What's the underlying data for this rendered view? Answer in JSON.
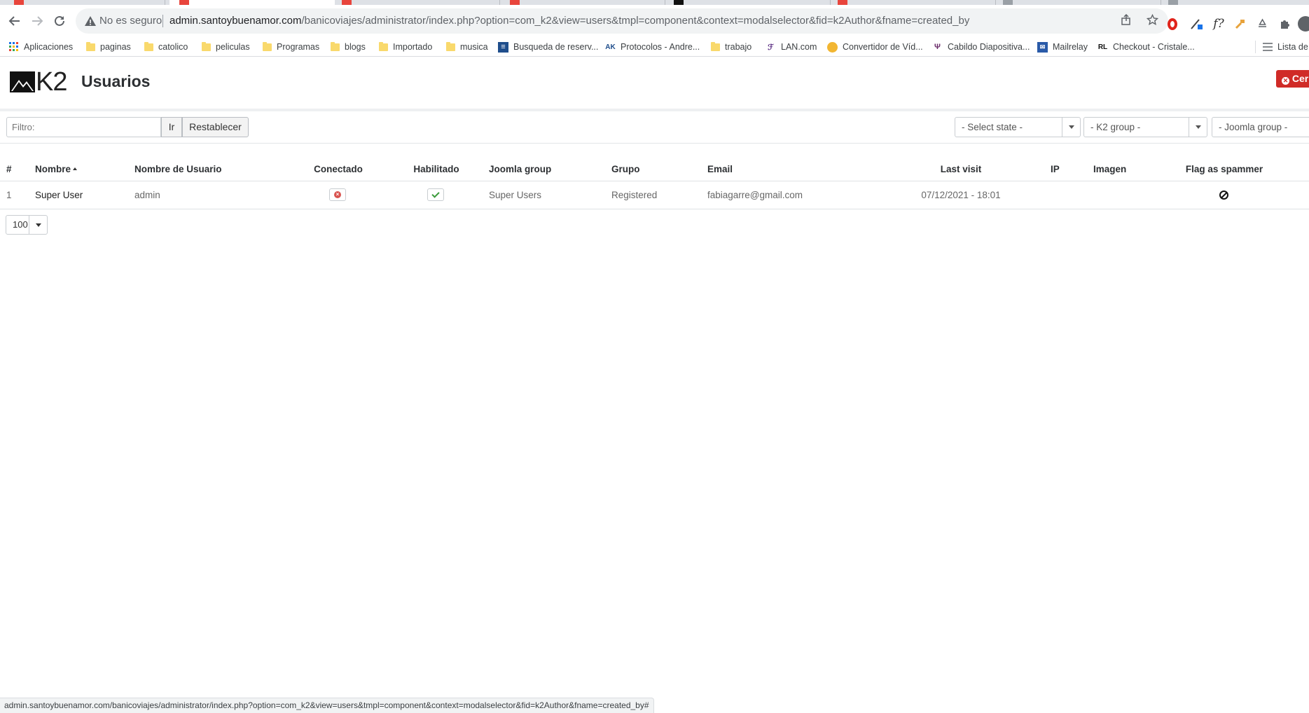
{
  "browser": {
    "security_text": "No es seguro",
    "url_host": "admin.santoybuenamor.com",
    "url_path": "/banicoviajes/administrator/index.php?option=com_k2&view=users&tmpl=component&context=modalselector&fid=k2Author&fname=created_by",
    "bookmarks": [
      {
        "label": "Aplicaciones",
        "icon": "apps-grid-icon"
      },
      {
        "label": "paginas",
        "icon": "folder-icon"
      },
      {
        "label": "catolico",
        "icon": "folder-icon"
      },
      {
        "label": "peliculas",
        "icon": "folder-icon"
      },
      {
        "label": "Programas",
        "icon": "folder-icon"
      },
      {
        "label": "blogs",
        "icon": "folder-icon"
      },
      {
        "label": "Importado",
        "icon": "folder-icon"
      },
      {
        "label": "musica",
        "icon": "folder-icon"
      },
      {
        "label": "Busqueda de reserv...",
        "icon": "site-icon"
      },
      {
        "label": "Protocolos - Andre...",
        "icon": "site-icon"
      },
      {
        "label": "trabajo",
        "icon": "folder-icon"
      },
      {
        "label": "LAN.com",
        "icon": "site-icon"
      },
      {
        "label": "Convertidor de Víd...",
        "icon": "site-icon"
      },
      {
        "label": "Cabildo Diapositiva...",
        "icon": "site-icon"
      },
      {
        "label": "Mailrelay",
        "icon": "site-icon"
      },
      {
        "label": "Checkout - Cristale...",
        "icon": "site-icon"
      }
    ],
    "reading_list": "Lista de",
    "ext_f_label": "f?",
    "rl_badge": "RL",
    "ak_badge": "AK"
  },
  "k2": {
    "logo_text": "K2",
    "title": "Usuarios",
    "close_label": "Cer",
    "filter_placeholder": "Filtro:",
    "go_label": "Ir",
    "reset_label": "Restablecer",
    "select_state": "- Select state -",
    "k2_group": "- K2 group -",
    "joomla_group": "- Joomla group -",
    "columns": {
      "num": "#",
      "name": "Nombre",
      "username": "Nombre de Usuario",
      "logged": "Conectado",
      "enabled": "Habilitado",
      "joomla_group": "Joomla group",
      "group": "Grupo",
      "email": "Email",
      "last_visit": "Last visit",
      "ip": "IP",
      "image": "Imagen",
      "spammer": "Flag as spammer"
    },
    "rows": [
      {
        "num": "1",
        "name": "Super User",
        "username": "admin",
        "logged_in": false,
        "enabled": true,
        "joomla_group": "Super Users",
        "group": "Registered",
        "email": "fabiagarre@gmail.com",
        "last_visit": "07/12/2021 - 18:01",
        "ip": "",
        "image": ""
      }
    ],
    "list_limit": "100"
  },
  "status_bar": "admin.santoybuenamor.com/banicoviajes/administrator/index.php?option=com_k2&view=users&tmpl=component&context=modalselector&fid=k2Author&fname=created_by#",
  "colors": {
    "close_button": "#d02b27",
    "disabled_dot": "#d9534f",
    "enabled_check": "#3a9a3a"
  }
}
